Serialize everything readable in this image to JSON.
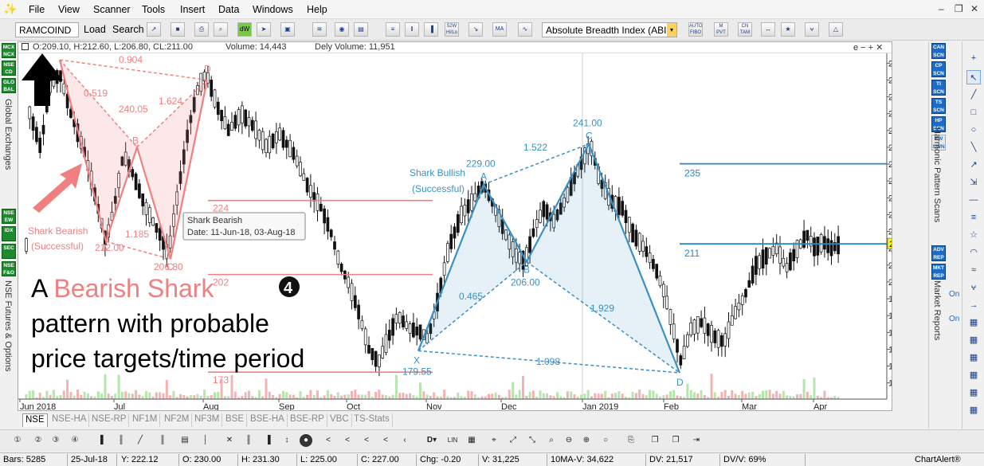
{
  "app": {
    "menu": [
      "File",
      "View",
      "Scanner",
      "Tools",
      "Insert",
      "Data",
      "Windows",
      "Help"
    ],
    "brand": "ChartAlert®"
  },
  "toolbar": {
    "symbol": "RAMCOIND",
    "load_label": "Load",
    "search_label": "Search",
    "icons": [
      "dW",
      "52W Hi/Lo",
      "MA",
      "AUTO FIBO",
      "M PVT",
      "CN TAM",
      "CN TAM"
    ],
    "indicator": "Absolute Breadth Index (ABI"
  },
  "header": {
    "ohlc": "O:209.10, H:212.60, L:206.80, CL:211.00",
    "volume": "Volume: 14,443",
    "dely_volume": "Dely Volume: 11,951",
    "controls": "e − + ✕"
  },
  "leftbar": {
    "badges": [
      "MCX NCX",
      "NSE CD",
      "GLO BAL",
      "NSE EW",
      "IDX",
      "SEC",
      "NSE F&O"
    ],
    "vlabels": [
      "Global Exchanges",
      "NSE Futures & Options"
    ]
  },
  "rightbar": {
    "badges": [
      "CAN SCN",
      "CP SCN",
      "TI SCN",
      "TS SCN",
      "HP SCN",
      "EW SWN",
      "ADV REP",
      "MKT REP",
      "On",
      "On"
    ],
    "vlabels": [
      "Harmonic Pattern Scans",
      "Market Reports"
    ]
  },
  "chart_data": {
    "type": "candlestick",
    "y_ticks": [
      265,
      260,
      255,
      250,
      245,
      240,
      235,
      230,
      225,
      220,
      215,
      210,
      205,
      200,
      195,
      190,
      185,
      180,
      175,
      170
    ],
    "ylim": [
      168.5,
      266.5
    ],
    "x_ticks": [
      "Jun 2018",
      "Jul",
      "Aug",
      "Sep",
      "Oct",
      "Nov",
      "Dec",
      "Jan 2019",
      "Feb",
      "Mar",
      "Apr"
    ],
    "last_price": "211",
    "bearish_shark": {
      "points": [
        {
          "label": "X",
          "value": 266
        },
        {
          "label": "A",
          "value": 212.0
        },
        {
          "label": "B",
          "value": 240.05
        },
        {
          "label": "C",
          "value": 206.8
        },
        {
          "label": "D",
          "value": 260
        }
      ],
      "ratios": [
        "0.904",
        "0.519",
        "1.624",
        "1.185"
      ],
      "value_labels": [
        "240.05",
        "212.00",
        "206.80"
      ],
      "title": "Shark Bearish",
      "status": "(Successful)",
      "targets": [
        "224",
        "202",
        "173"
      ],
      "tooltip_title": "Shark Bearish",
      "tooltip_date": "Date: 11-Jun-18, 03-Aug-18"
    },
    "bullish_shark": {
      "points": [
        {
          "label": "X",
          "value": 179.55
        },
        {
          "label": "A",
          "value": 229.0
        },
        {
          "label": "B",
          "value": 206.0
        },
        {
          "label": "C",
          "value": 241.0
        },
        {
          "label": "D",
          "value": 173
        }
      ],
      "ratios": [
        "0.465",
        "1.522",
        "1.929",
        "1.098"
      ],
      "title": "Shark Bullish",
      "status": "(Successful)",
      "targets": [
        "235",
        "211"
      ]
    },
    "annotation": {
      "line1_prefix": "A ",
      "line1_highlight": "Bearish Shark",
      "line2": "pattern with probable",
      "line3": "price targets/time period",
      "badge": "4"
    }
  },
  "exchange_tabs": [
    "NSE",
    "NSE-HA",
    "NSE-RP",
    "NF1M",
    "NF2M",
    "NF3M",
    "BSE",
    "BSE-HA",
    "BSE-RP",
    "VBC",
    "TS-Stats"
  ],
  "status": {
    "bars": "Bars: 5285",
    "date": "25-Jul-18",
    "y": "Y: 222.12",
    "o": "O: 230.00",
    "h": "H: 231.30",
    "l": "L: 225.00",
    "c": "C: 227.00",
    "chg": "Chg: -0.20",
    "v": "V: 31,225",
    "ma_v": "10MA-V: 34,622",
    "dv": "DV: 21,517",
    "dvv": "DV/V: 69%"
  },
  "colors": {
    "bearish": "#f08080",
    "bullish": "#3a8fc4",
    "badge_green": "#1d8a2e",
    "badge_blue": "#1b6cc8"
  }
}
